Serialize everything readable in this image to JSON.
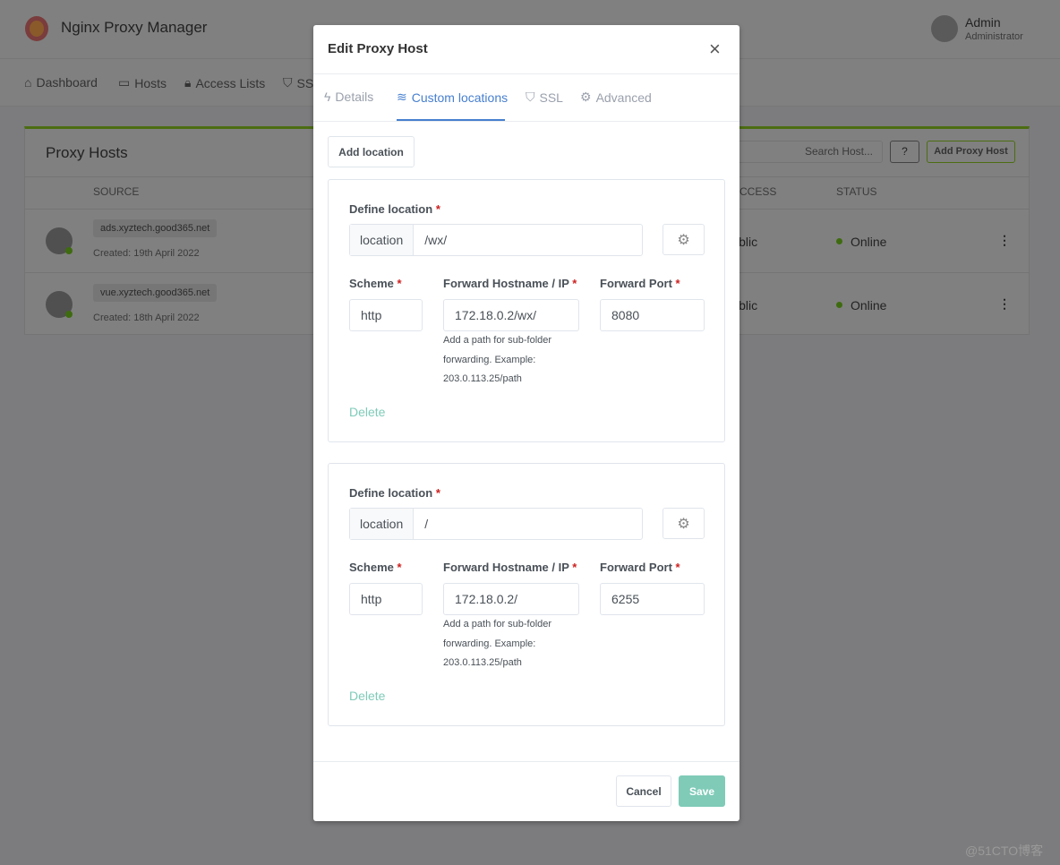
{
  "app": {
    "title": "Nginx Proxy Manager",
    "user_name": "Admin",
    "user_role": "Administrator"
  },
  "nav": [
    "Dashboard",
    "Hosts",
    "Access Lists",
    "SSL"
  ],
  "card": {
    "title": "Proxy Hosts",
    "search_placeholder": "Search Host...",
    "help": "?",
    "add_button": "Add Proxy Host",
    "columns": {
      "source": "SOURCE",
      "access": "ACCESS",
      "status": "STATUS"
    },
    "rows": [
      {
        "domain": "ads.xyztech.good365.net",
        "created": "Created: 19th April 2022",
        "access": "Public",
        "status": "Online"
      },
      {
        "domain": "vue.xyztech.good365.net",
        "created": "Created: 18th April 2022",
        "access": "Public",
        "status": "Online"
      }
    ]
  },
  "modal": {
    "title": "Edit Proxy Host",
    "close": "×",
    "tabs": [
      "Details",
      "Custom locations",
      "SSL",
      "Advanced"
    ],
    "active_tab": "Custom locations",
    "add_location": "Add location",
    "labels": {
      "define": "Define location",
      "scheme": "Scheme",
      "host": "Forward Hostname / IP",
      "port": "Forward Port",
      "required": "*",
      "prefix": "location",
      "help": "Add a path for sub-folder forwarding. Example: 203.0.113.25/path",
      "delete": "Delete"
    },
    "locations": [
      {
        "path": "/wx/",
        "scheme": "http",
        "host": "172.18.0.2/wx/",
        "port": "8080"
      },
      {
        "path": "/",
        "scheme": "http",
        "host": "172.18.0.2/",
        "port": "6255"
      }
    ],
    "cancel": "Cancel",
    "save": "Save"
  },
  "watermark": "@51CTO博客",
  "colors": {
    "accent": "#467fcf",
    "online": "#5eba00",
    "save": "#7fcbb8",
    "required": "#cd201f"
  }
}
